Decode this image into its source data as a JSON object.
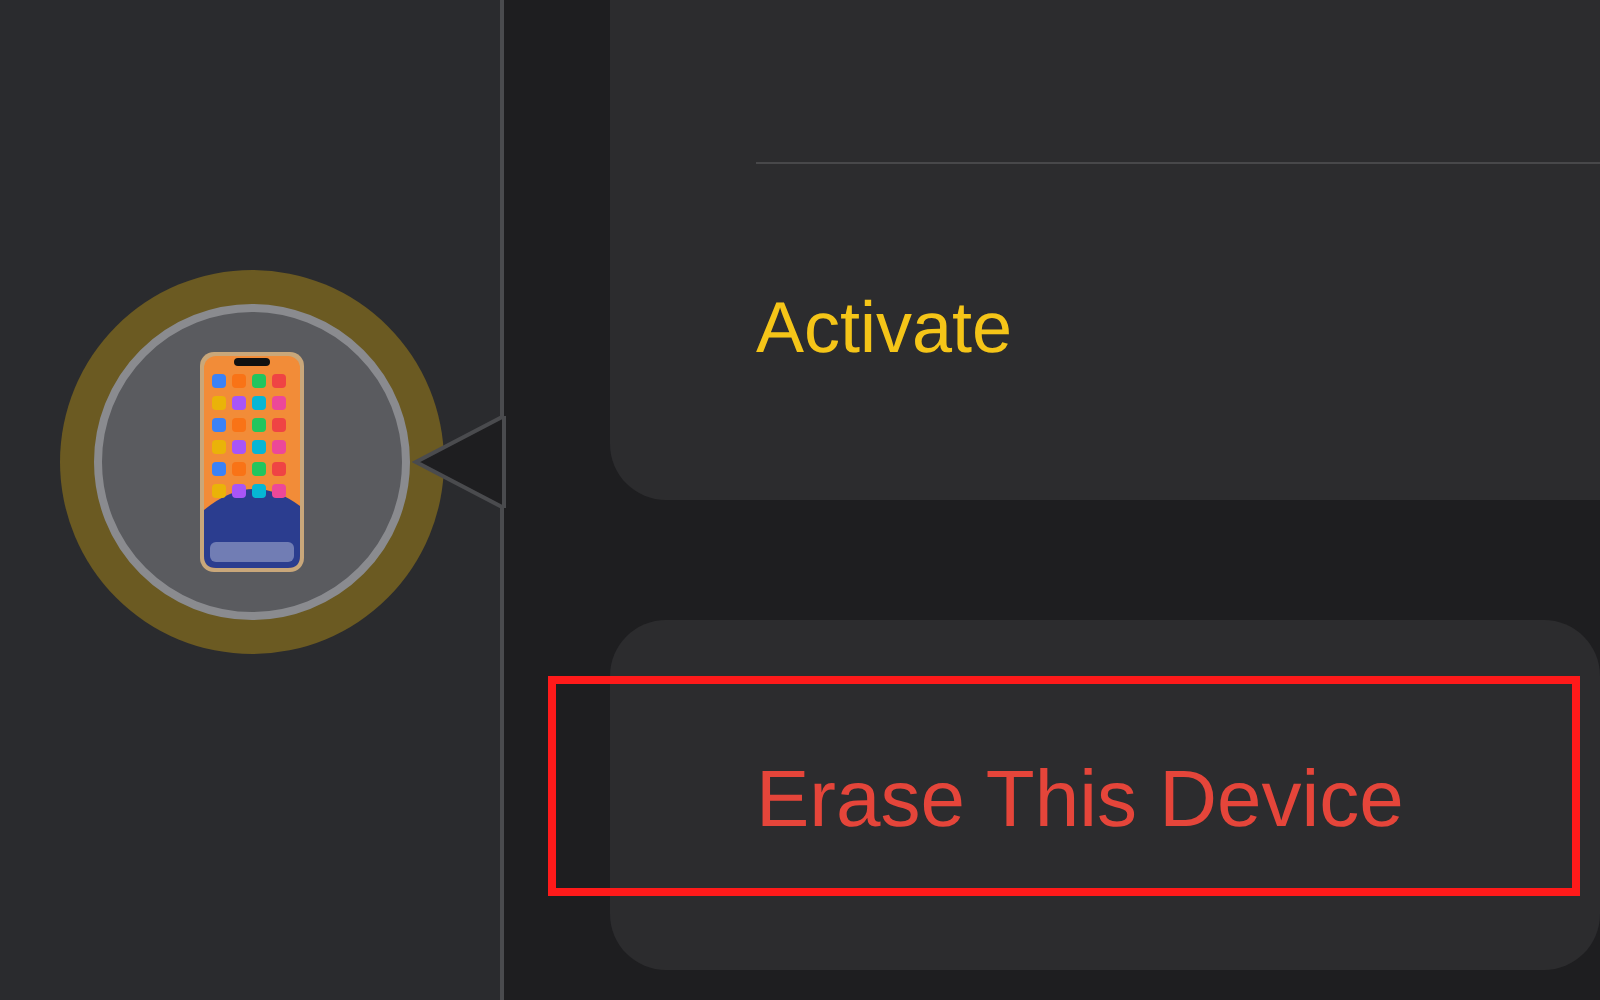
{
  "actions": [
    {
      "label": "Activate",
      "kind": "primary",
      "highlighted": false
    },
    {
      "label": "Erase This Device",
      "kind": "destructive",
      "highlighted": true
    }
  ]
}
